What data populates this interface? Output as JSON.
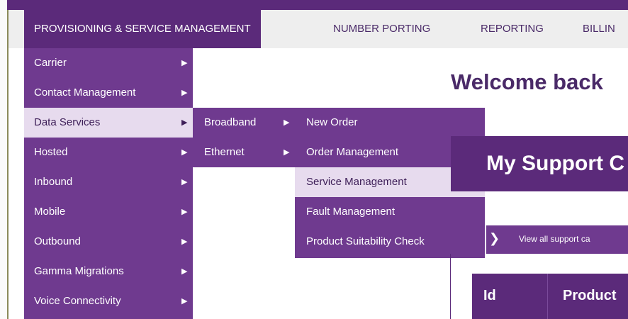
{
  "nav": {
    "items": [
      "PROVISIONING & SERVICE MANAGEMENT",
      "NUMBER PORTING",
      "REPORTING",
      "BILLIN"
    ],
    "active_index": 0
  },
  "menu_level1": {
    "items": [
      "Carrier",
      "Contact Management",
      "Data Services",
      "Hosted",
      "Inbound",
      "Mobile",
      "Outbound",
      "Gamma Migrations",
      "Voice Connectivity"
    ],
    "highlighted": "Data Services"
  },
  "menu_level2": {
    "items": [
      "Broadband",
      "Ethernet"
    ]
  },
  "menu_level3": {
    "items": [
      "New Order",
      "Order Management",
      "Service Management",
      "Fault Management",
      "Product Suitability Check"
    ],
    "highlighted": "Service Management"
  },
  "icons": {
    "submenu_arrow": "▶",
    "view_arrow": "❯"
  },
  "main": {
    "welcome": "Welcome back",
    "support_title": "My Support C",
    "view_all": "View all support ca",
    "table_headers": [
      "Id",
      "Product"
    ]
  },
  "colors": {
    "purple_dark": "#5b2a7a",
    "purple_menu": "#6f3a8f",
    "highlight": "#e7dbee",
    "nav_bg": "#eeeeee"
  }
}
